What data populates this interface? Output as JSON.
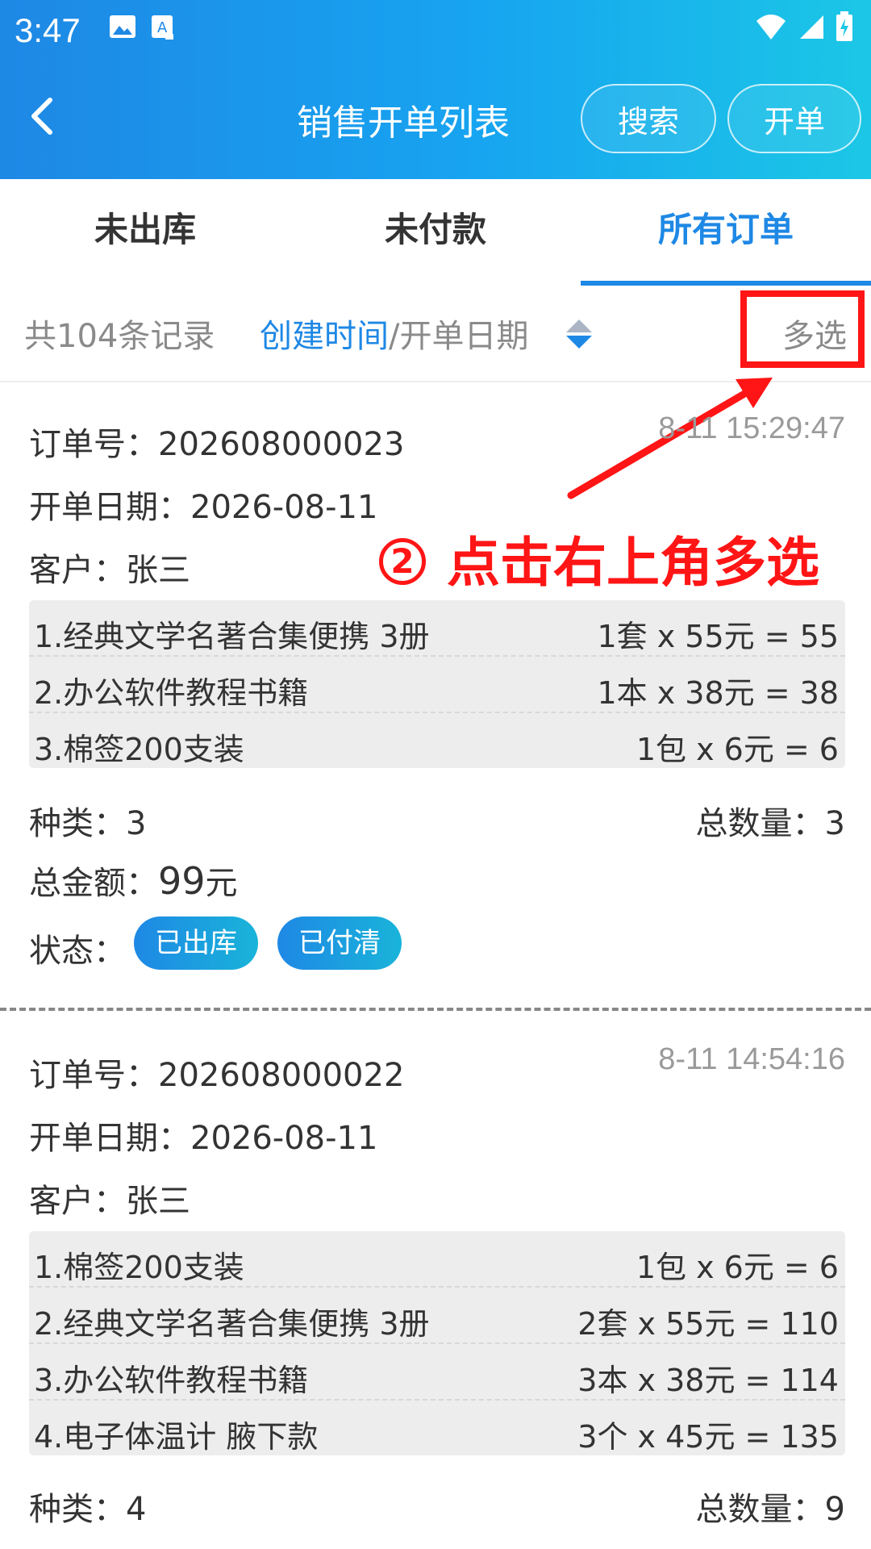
{
  "status": {
    "time": "3:47"
  },
  "header": {
    "title": "销售开单列表",
    "search_label": "搜索",
    "create_label": "开单"
  },
  "tabs": [
    {
      "label": "未出库"
    },
    {
      "label": "未付款"
    },
    {
      "label": "所有订单",
      "active": true
    }
  ],
  "filter": {
    "count_text": "共104条记录",
    "sort_active": "创建时间",
    "sort_separator": "/",
    "sort_other": "开单日期",
    "multi_select": "多选"
  },
  "annotation": {
    "number": "2",
    "text": "点击右上角多选"
  },
  "orders": [
    {
      "order_no": "订单号：202608000023",
      "timestamp": "8-11 15:29:47",
      "date": "开单日期：2026-08-11",
      "customer": "客户：张三",
      "items": [
        {
          "name": "1.经典文学名著合集便携 3册",
          "price": "1套 x 55元 = 55"
        },
        {
          "name": "2.办公软件教程书籍",
          "price": "1本 x 38元 = 38"
        },
        {
          "name": "3.棉签200支装",
          "price": "1包 x 6元 = 6"
        }
      ],
      "kinds": "种类：3",
      "total_qty": "总数量：3",
      "amount_label": "总金额：",
      "amount_value": "99",
      "amount_unit": "元",
      "status_label": "状态：",
      "badges": [
        "已出库",
        "已付清"
      ]
    },
    {
      "order_no": "订单号：202608000022",
      "timestamp": "8-11 14:54:16",
      "date": "开单日期：2026-08-11",
      "customer": "客户：张三",
      "items": [
        {
          "name": "1.棉签200支装",
          "price": "1包 x 6元 = 6"
        },
        {
          "name": "2.经典文学名著合集便携 3册",
          "price": "2套 x 55元 = 110"
        },
        {
          "name": "3.办公软件教程书籍",
          "price": "3本 x 38元 = 114"
        },
        {
          "name": "4.电子体温计 腋下款",
          "price": "3个 x 45元 = 135"
        }
      ],
      "kinds": "种类：4",
      "total_qty": "总数量：9"
    }
  ],
  "colors": {
    "accent": "#1e88e5",
    "annotation": "#ff1515"
  }
}
